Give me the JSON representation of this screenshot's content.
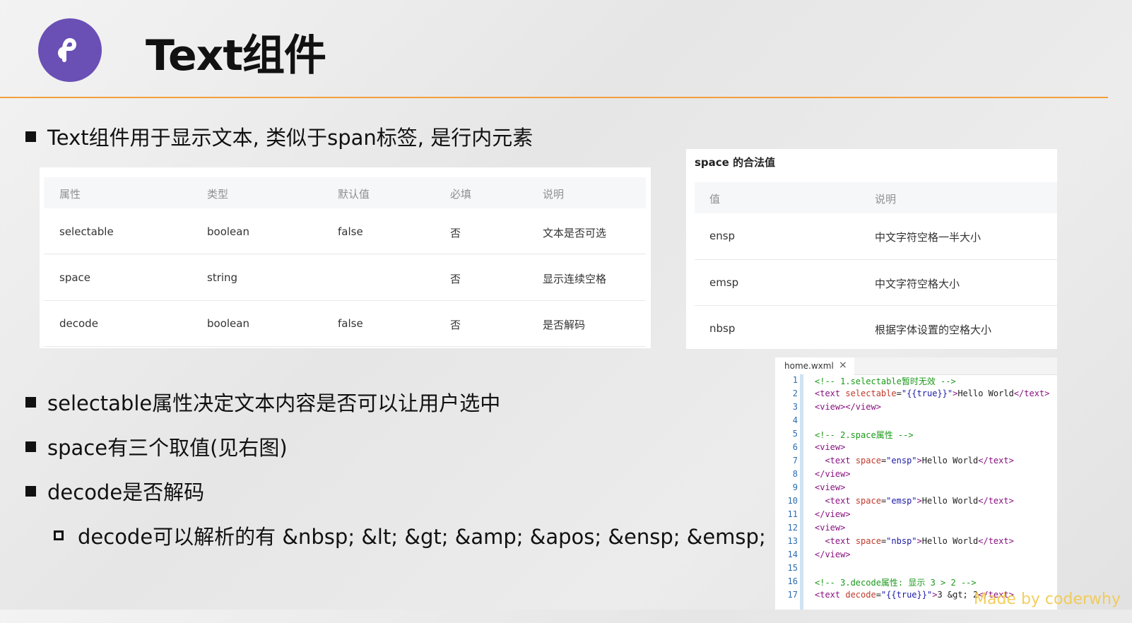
{
  "slide": {
    "title": "Text组件",
    "bullets": [
      "Text组件用于显示文本, 类似于span标签, 是行内元素",
      "selectable属性决定文本内容是否可以让用户选中",
      "space有三个取值(见右图)",
      "decode是否解码"
    ],
    "sub_bullet": "decode可以解析的有 &nbsp; &lt; &gt; &amp; &apos; &ensp; &emsp;",
    "watermark": "Made by coderwhy"
  },
  "attr_table": {
    "headers": [
      "属性",
      "类型",
      "默认值",
      "必填",
      "说明"
    ],
    "rows": [
      [
        "selectable",
        "boolean",
        "false",
        "否",
        "文本是否可选"
      ],
      [
        "space",
        "string",
        "",
        "否",
        "显示连续空格"
      ],
      [
        "decode",
        "boolean",
        "false",
        "否",
        "是否解码"
      ]
    ]
  },
  "space_table": {
    "caption": "space 的合法值",
    "headers": [
      "值",
      "说明"
    ],
    "rows": [
      [
        "ensp",
        "中文字符空格一半大小"
      ],
      [
        "emsp",
        "中文字符空格大小"
      ],
      [
        "nbsp",
        "根据字体设置的空格大小"
      ]
    ]
  },
  "code_editor": {
    "tab_name": "home.wxml",
    "close_glyph": "×",
    "lines": [
      {
        "n": "1",
        "parts": [
          [
            "com",
            "<!-- 1.selectable暂时无效 -->"
          ]
        ]
      },
      {
        "n": "2",
        "parts": [
          [
            "tag",
            "<text "
          ],
          [
            "attr",
            "selectable"
          ],
          [
            "txt",
            "="
          ],
          [
            "str",
            "\"{{true}}\""
          ],
          [
            "tag",
            ">"
          ],
          [
            "txt",
            "Hello World"
          ],
          [
            "tag",
            "</text>"
          ]
        ]
      },
      {
        "n": "3",
        "parts": [
          [
            "tag",
            "<view></view>"
          ]
        ]
      },
      {
        "n": "4",
        "parts": []
      },
      {
        "n": "5",
        "parts": [
          [
            "com",
            "<!-- 2.space属性 -->"
          ]
        ]
      },
      {
        "n": "6",
        "parts": [
          [
            "tag",
            "<view>"
          ]
        ]
      },
      {
        "n": "7",
        "parts": [
          [
            "txt",
            "  "
          ],
          [
            "tag",
            "<text "
          ],
          [
            "attr",
            "space"
          ],
          [
            "txt",
            "="
          ],
          [
            "str",
            "\"ensp\""
          ],
          [
            "tag",
            ">"
          ],
          [
            "txt",
            "Hello World"
          ],
          [
            "tag",
            "</text>"
          ]
        ]
      },
      {
        "n": "8",
        "parts": [
          [
            "tag",
            "</view>"
          ]
        ]
      },
      {
        "n": "9",
        "parts": [
          [
            "tag",
            "<view>"
          ]
        ]
      },
      {
        "n": "10",
        "parts": [
          [
            "txt",
            "  "
          ],
          [
            "tag",
            "<text "
          ],
          [
            "attr",
            "space"
          ],
          [
            "txt",
            "="
          ],
          [
            "str",
            "\"emsp\""
          ],
          [
            "tag",
            ">"
          ],
          [
            "txt",
            "Hello World"
          ],
          [
            "tag",
            "</text>"
          ]
        ]
      },
      {
        "n": "11",
        "parts": [
          [
            "tag",
            "</view>"
          ]
        ]
      },
      {
        "n": "12",
        "parts": [
          [
            "tag",
            "<view>"
          ]
        ]
      },
      {
        "n": "13",
        "parts": [
          [
            "txt",
            "  "
          ],
          [
            "tag",
            "<text "
          ],
          [
            "attr",
            "space"
          ],
          [
            "txt",
            "="
          ],
          [
            "str",
            "\"nbsp\""
          ],
          [
            "tag",
            ">"
          ],
          [
            "txt",
            "Hello World"
          ],
          [
            "tag",
            "</text>"
          ]
        ]
      },
      {
        "n": "14",
        "parts": [
          [
            "tag",
            "</view>"
          ]
        ]
      },
      {
        "n": "15",
        "parts": []
      },
      {
        "n": "16",
        "parts": [
          [
            "com",
            "<!-- 3.decode属性: 显示 3 > 2 -->"
          ]
        ]
      },
      {
        "n": "17",
        "parts": [
          [
            "tag",
            "<text "
          ],
          [
            "attr",
            "decode"
          ],
          [
            "txt",
            "="
          ],
          [
            "str",
            "\"{{true}}\""
          ],
          [
            "tag",
            ">"
          ],
          [
            "txt",
            "3 &gt; 2"
          ],
          [
            "tag",
            "</text>"
          ]
        ]
      }
    ]
  },
  "colors": {
    "accent_rule": "#f2a03d",
    "logo_bg": "#6a4fb5",
    "comment": "#1a9a1a",
    "tag": "#881280",
    "attr": "#c0392b",
    "string": "#1a1aa6",
    "line_number": "#2b6cb0"
  },
  "icons": {
    "logo": "mini-program-logo-icon",
    "bullet": "square-bullet-icon",
    "sub_bullet": "hollow-square-bullet-icon",
    "tab_close": "close-icon"
  }
}
